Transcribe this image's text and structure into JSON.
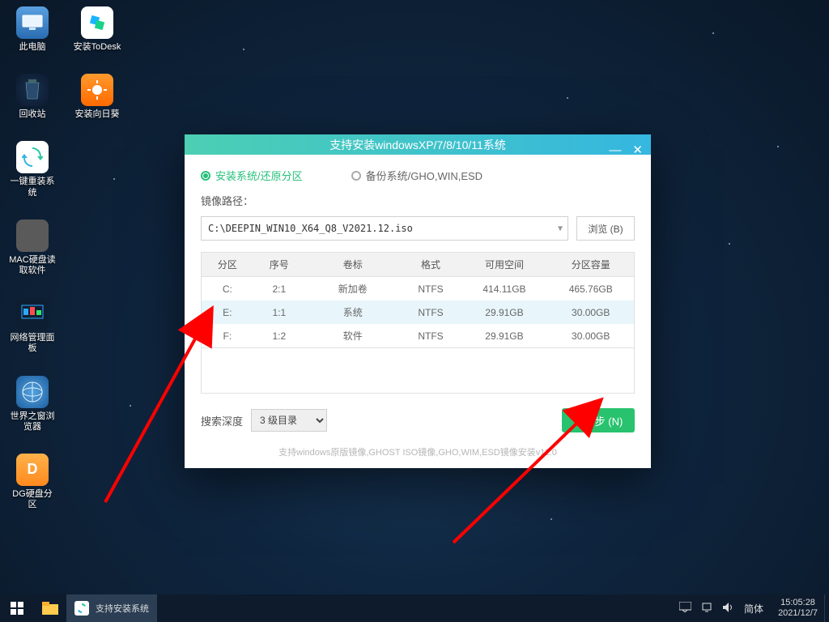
{
  "desktop": {
    "icons": [
      {
        "label": "此电脑"
      },
      {
        "label": "安装ToDesk"
      },
      {
        "label": "回收站"
      },
      {
        "label": "安装向日葵"
      },
      {
        "label": "一键重装系统"
      },
      {
        "label": "MAC硬盘读取软件"
      },
      {
        "label": "网络管理面板"
      },
      {
        "label": "世界之窗浏览器"
      },
      {
        "label": "DG硬盘分区"
      }
    ]
  },
  "dialog": {
    "title": "支持安装windowsXP/7/8/10/11系统",
    "radios": {
      "install": "安装系统/还原分区",
      "backup": "备份系统/GHO,WIN,ESD"
    },
    "path_label": "镜像路径：",
    "path_value": "C:\\DEEPIN_WIN10_X64_Q8_V2021.12.iso",
    "browse": "浏览 (B)",
    "table": {
      "headers": [
        "分区",
        "序号",
        "卷标",
        "格式",
        "可用空间",
        "分区容量"
      ],
      "rows": [
        {
          "part": "C:",
          "seq": "2:1",
          "vol": "新加卷",
          "fmt": "NTFS",
          "free": "414.11GB",
          "cap": "465.76GB"
        },
        {
          "part": "E:",
          "seq": "1:1",
          "vol": "系统",
          "fmt": "NTFS",
          "free": "29.91GB",
          "cap": "30.00GB"
        },
        {
          "part": "F:",
          "seq": "1:2",
          "vol": "软件",
          "fmt": "NTFS",
          "free": "29.91GB",
          "cap": "30.00GB"
        }
      ]
    },
    "search_depth_label": "搜索深度",
    "search_depth_value": "3 级目录",
    "next": "下一步 (N)",
    "footnote": "支持windows原版镜像,GHOST ISO镜像,GHO,WIM,ESD镜像安装v11.0"
  },
  "taskbar": {
    "app": "支持安装系统",
    "ime": "简体",
    "time": "15:05:28",
    "date": "2021/12/7"
  }
}
